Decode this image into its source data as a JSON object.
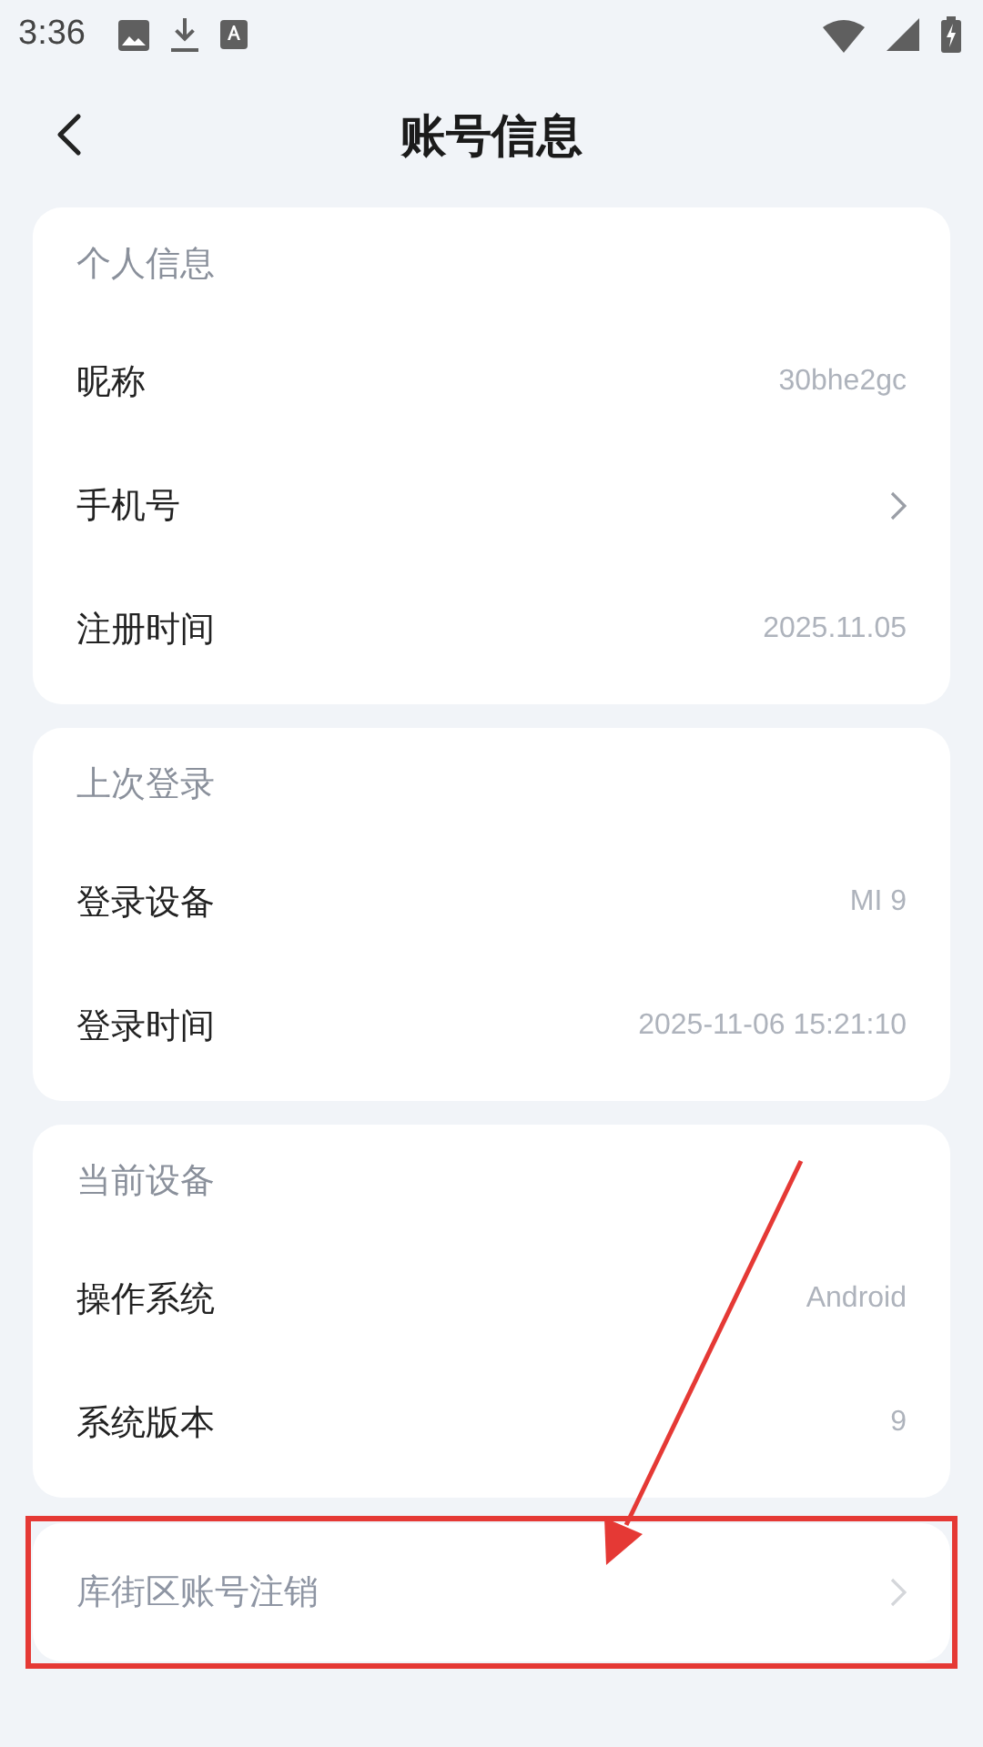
{
  "status_bar": {
    "time": "3:36"
  },
  "header": {
    "title": "账号信息"
  },
  "sections": [
    {
      "title": "个人信息",
      "rows": [
        {
          "label": "昵称",
          "kind": "value",
          "value": "30bhe2gc"
        },
        {
          "label": "手机号",
          "kind": "link"
        },
        {
          "label": "注册时间",
          "kind": "value",
          "value": "2025.11.05"
        }
      ]
    },
    {
      "title": "上次登录",
      "rows": [
        {
          "label": "登录设备",
          "kind": "value",
          "value": "MI 9"
        },
        {
          "label": "登录时间",
          "kind": "value",
          "value": "2025-11-06 15:21:10"
        }
      ]
    },
    {
      "title": "当前设备",
      "rows": [
        {
          "label": "操作系统",
          "kind": "value",
          "value": "Android"
        },
        {
          "label": "系统版本",
          "kind": "value",
          "value": "9"
        }
      ]
    }
  ],
  "deregister": {
    "label": "库街区账号注销",
    "highlighted": true
  }
}
